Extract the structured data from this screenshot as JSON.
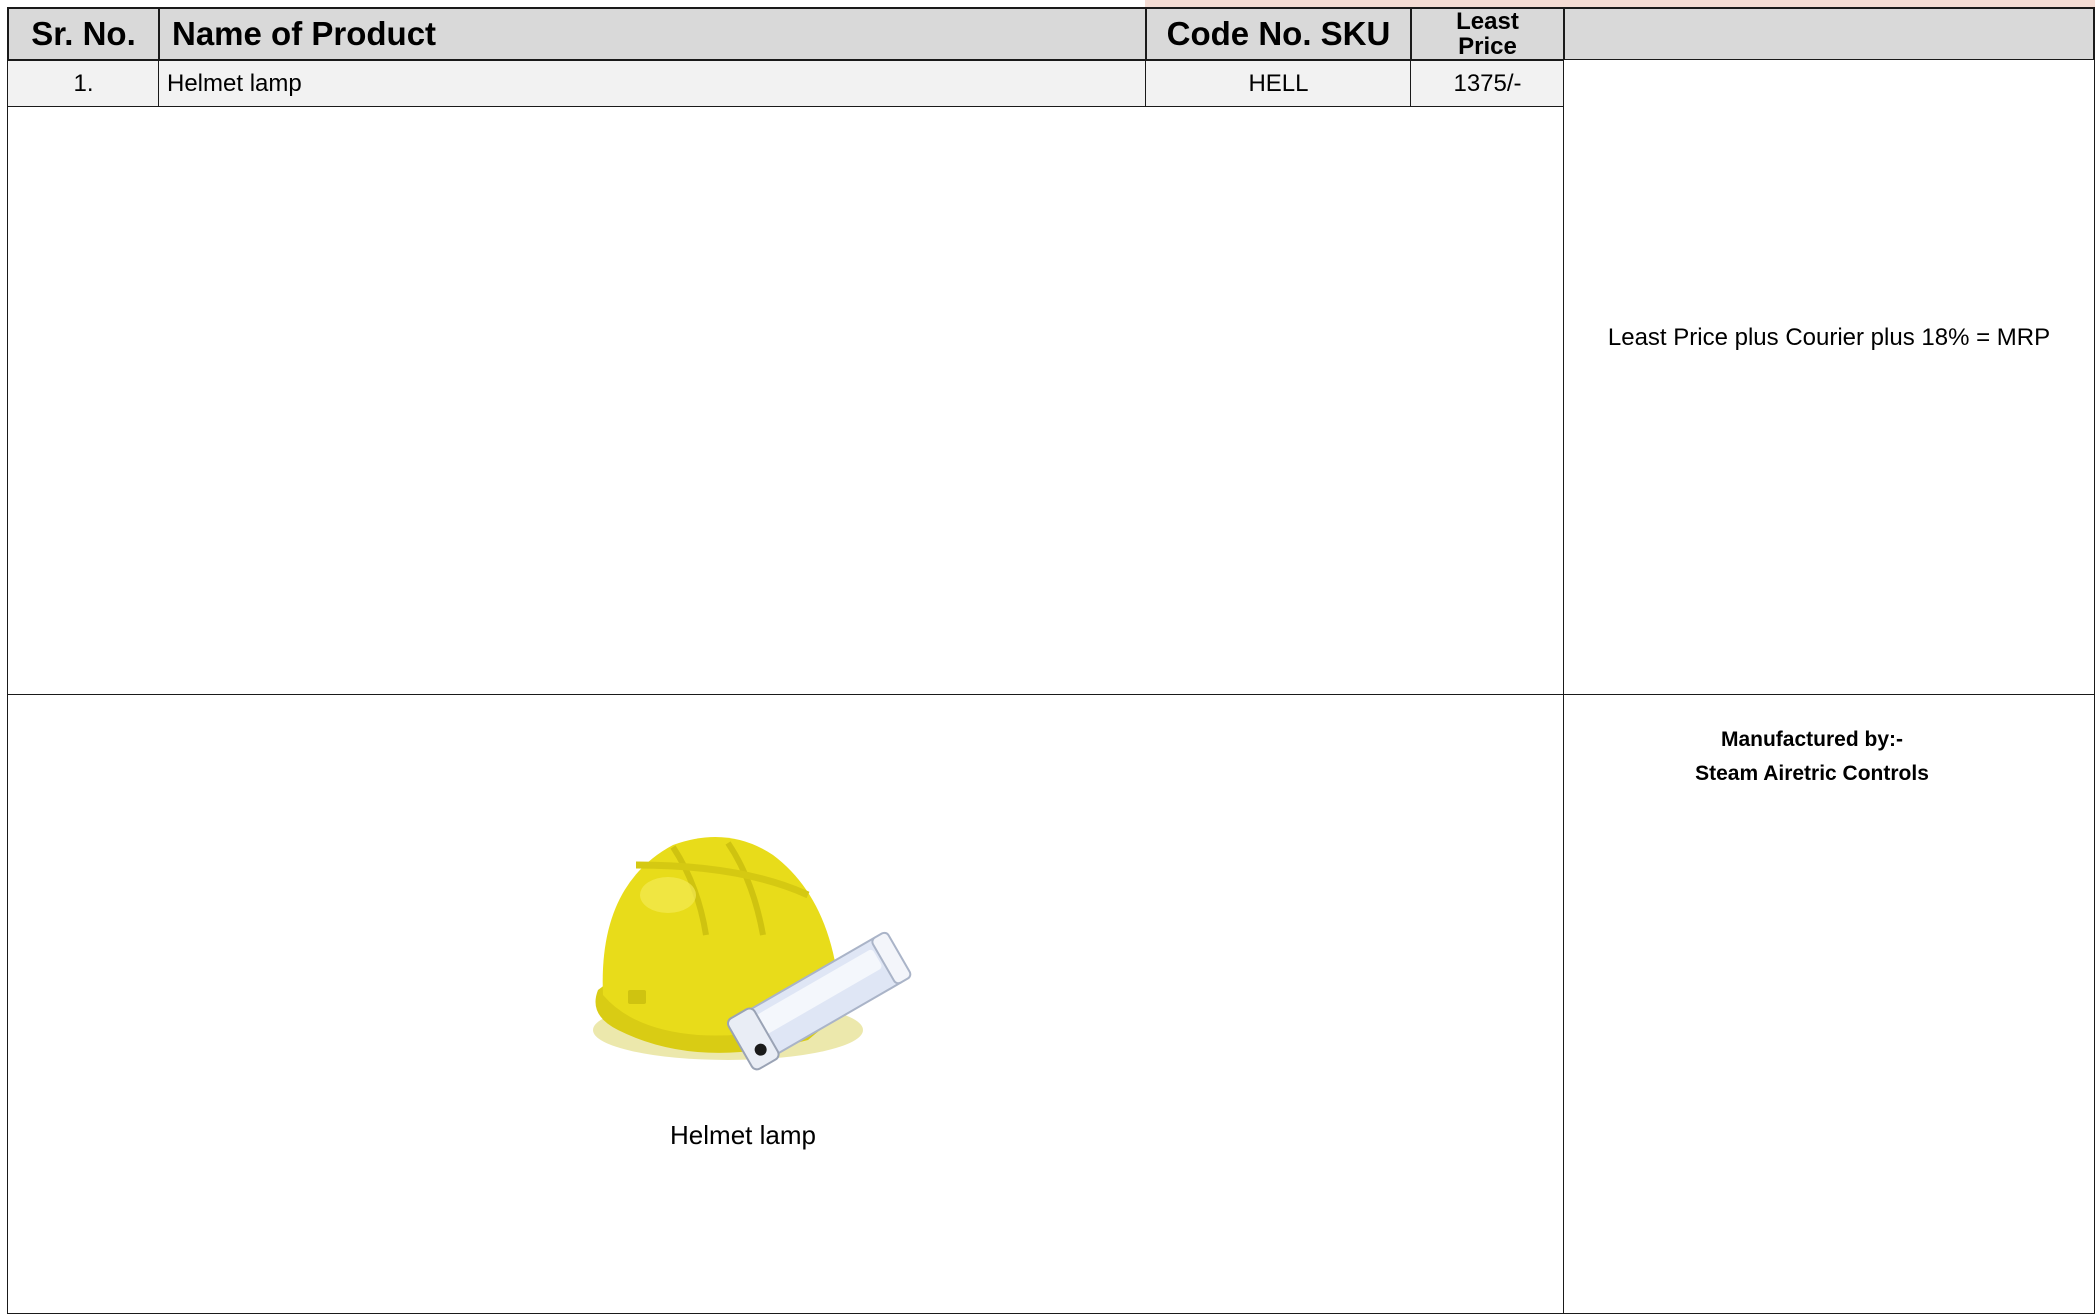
{
  "header": {
    "sr_no": "Sr. No.",
    "name": "Name of Product",
    "code": "Code No. SKU",
    "price_line1": "Least",
    "price_line2": "Price"
  },
  "rows": [
    {
      "sr_no": "1.",
      "name": "Helmet lamp",
      "code": "HELL",
      "price": "1375/-"
    }
  ],
  "side": {
    "pricing_note": "Least Price plus Courier plus 18% = MRP",
    "manufacturer_label": "Manufactured by:-",
    "manufacturer_name": "Steam Airetric Controls"
  },
  "product_image": {
    "caption": "Helmet lamp",
    "helmet_color": "#e8dc1a",
    "lamp_color": "#dfe6f5"
  },
  "colors": {
    "header_bg": "#d9d9d9",
    "row_bg": "#f2f2f2",
    "border": "#1a1a1a"
  }
}
